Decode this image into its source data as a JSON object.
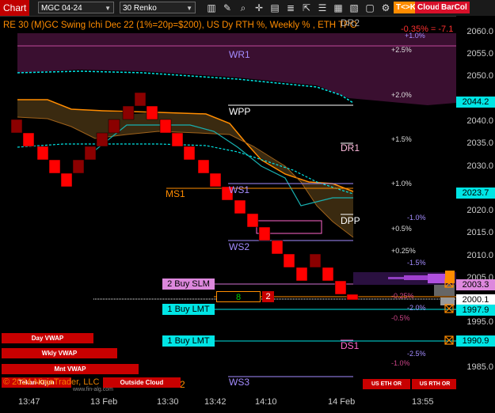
{
  "toolbar": {
    "chart_tab": "Chart",
    "instrument": "MGC 04-24",
    "bar_type": "30 Renko",
    "icons": [
      "bar-chart-icon",
      "pencil-icon",
      "zoom-icon",
      "crosshair-icon",
      "data-box-icon",
      "properties-icon",
      "pointer-icon",
      "chart-list-icon",
      "calendar-icon",
      "dom-icon",
      "window-icon",
      "strategy-icon"
    ],
    "btn_tck": "T<>K",
    "btn_cloud": "Cloud",
    "btn_barcol": "BarCol"
  },
  "header": {
    "title": "RE 30 (M)GC Swing Ichi Dec 22 (1%=20p=$200), US Dy RTH %, Weekly % , ETH TPO",
    "change": "-0.35% = -7.1",
    "pct_top": "+1.0%"
  },
  "levels": {
    "dr2": "DR2",
    "wr1": "WR1",
    "wpp": "WPP",
    "dr1": "DR1",
    "ms1": "MS1",
    "ws1": "WS1",
    "dpp": "DPP",
    "ws2": "WS2",
    "ds1": "DS1",
    "ws3": "WS3",
    "ms2": "MS2"
  },
  "pcts": {
    "p25": "+2.5%",
    "p20": "+2.0%",
    "p15": "+1.5%",
    "p10": "+1.0%",
    "n10": "-1.0%",
    "p05": "+0.5%",
    "p025": "+0.25%",
    "n15": "-1.5%",
    "n025": "-0.25%",
    "n20": "-2.0%",
    "n05": "-0.5%",
    "n25": "-2.5%",
    "n10b": "-1.0%"
  },
  "orders": {
    "buy_slm": "2 Buy SLM",
    "buy_lmt1": "1 Buy LMT",
    "buy_lmt2": "1 Buy LMT",
    "pos_qty": "8",
    "pos_qty2": "2"
  },
  "price_axis": {
    "labels": [
      "2060.0",
      "2055.0",
      "2050.0",
      "2040.0",
      "2035.0",
      "2030.0",
      "2020.0",
      "2015.0",
      "2010.0",
      "2005.0",
      "1995.0",
      "1985.0"
    ],
    "hl_2044": "2044.2",
    "hl_2023": "2023.7",
    "hl_2003": "2003.3",
    "hl_2000": "2000.1",
    "hl_1997": "1997.9",
    "hl_1990": "1990.9"
  },
  "time_axis": [
    "13:47",
    "13 Feb",
    "13:30",
    "13:42",
    "14:10",
    "14 Feb",
    "13:55"
  ],
  "bottom_panel": {
    "day_vwap": "Day VWAP",
    "wkly_vwap": "Wkly VWAP",
    "mnt_vwap": "Mnt VWAP",
    "tekan_kijun": "Tekan-Kijun",
    "outside_cloud": "Outside Cloud",
    "copyright": "© 2024 NinjaTrader, LLC",
    "watermark": "www.fin-alg.com",
    "us_eth_or": "US ETH OR",
    "us_rth_or": "US RTH OR"
  },
  "colors": {
    "bar_red": "#ff0000",
    "bar_dark": "#8b0000",
    "cloud_purple": "#3a0f30",
    "cloud_brown": "#3a2a10",
    "orange": "#ff8c00",
    "cyan": "#00e5e5",
    "pink": "#ff66cc",
    "lavender": "#a48cff"
  }
}
